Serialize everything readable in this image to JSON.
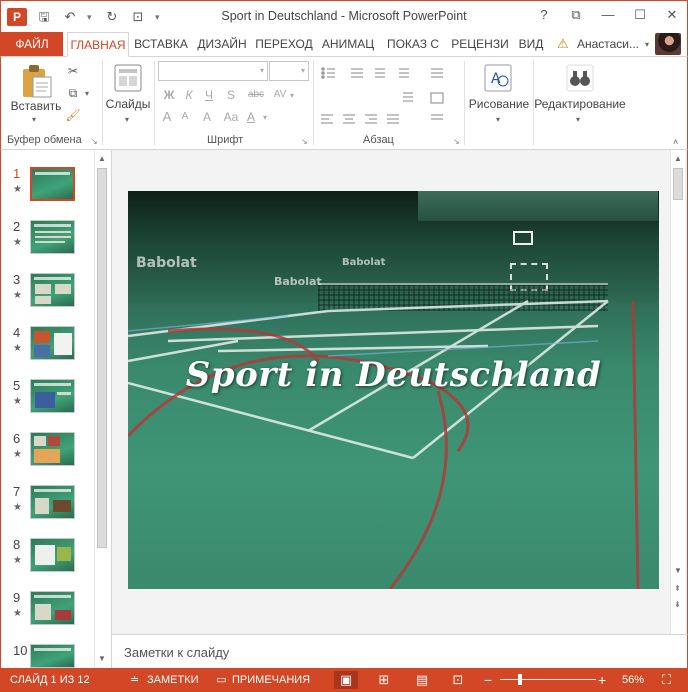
{
  "window": {
    "title": "Sport in Deutschland - Microsoft PowerPoint",
    "app_logo": "P",
    "qat": [
      {
        "icon": "save-icon",
        "glyph": "🖫"
      },
      {
        "icon": "undo-icon",
        "glyph": "↶"
      },
      {
        "icon": "redo-icon",
        "glyph": "↻"
      },
      {
        "icon": "start-from-beginning-icon",
        "glyph": "⊡"
      }
    ],
    "controls": {
      "help": "?",
      "ribbon_display": "⧉",
      "minimize": "—",
      "maximize": "☐",
      "close": "✕"
    }
  },
  "tabs": {
    "file": "ФАЙЛ",
    "items": [
      "ГЛАВНАЯ",
      "ВСТАВКА",
      "ДИЗАЙН",
      "ПЕРЕХОД",
      "АНИМАЦ",
      "ПОКАЗ С",
      "РЕЦЕНЗИ",
      "ВИД"
    ],
    "active_index": 0,
    "user_name": "Анастаси..."
  },
  "ribbon": {
    "clipboard": {
      "paste": "Вставить",
      "label": "Буфер обмена"
    },
    "slides": {
      "label_btn": "Слайды"
    },
    "font": {
      "label": "Шрифт",
      "bold": "Ж",
      "italic": "К",
      "underline": "Ч",
      "strike": "abc",
      "shadow": "S",
      "spacing": "AV",
      "size_up": "A",
      "size_down": "A",
      "clear": "A",
      "color": "A"
    },
    "paragraph": {
      "label": "Абзац"
    },
    "drawing": {
      "label": "Рисование"
    },
    "editing": {
      "label": "Редактирование"
    }
  },
  "thumbnails": {
    "active_index": 0,
    "items": [
      {
        "num": "1"
      },
      {
        "num": "2"
      },
      {
        "num": "3"
      },
      {
        "num": "4"
      },
      {
        "num": "5"
      },
      {
        "num": "6"
      },
      {
        "num": "7"
      },
      {
        "num": "8"
      },
      {
        "num": "9"
      },
      {
        "num": "10"
      }
    ],
    "star": "★"
  },
  "slide": {
    "title": "Sport in Deutschland",
    "brand_marks": [
      "Babolat",
      "Babolat",
      "Babolat"
    ]
  },
  "notes": {
    "placeholder": "Заметки к слайду"
  },
  "status": {
    "slide_counter": "СЛАЙД 1 ИЗ 12",
    "notes_btn": "ЗАМЕТКИ",
    "comments_btn": "ПРИМЕЧАНИЯ",
    "zoom": "56%",
    "zoom_minus": "−",
    "zoom_plus": "+"
  },
  "colors": {
    "accent": "#d24726"
  }
}
